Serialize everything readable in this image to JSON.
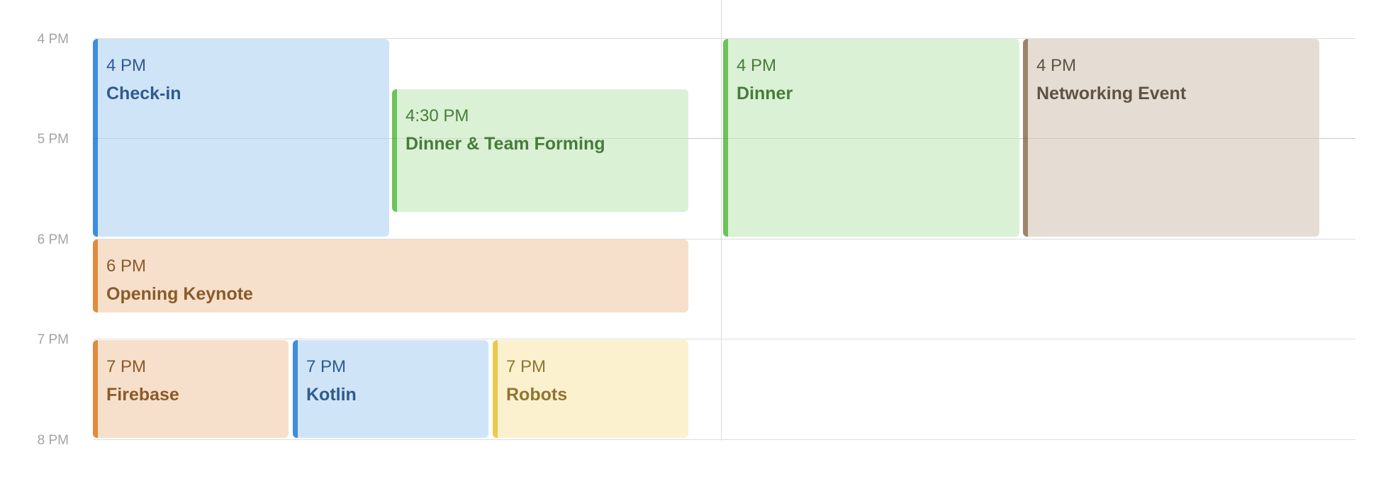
{
  "timeline": {
    "hours": [
      "4 PM",
      "5 PM",
      "6 PM",
      "7 PM",
      "8 PM"
    ]
  },
  "events": {
    "checkin": {
      "time": "4 PM",
      "title": "Check-in"
    },
    "dinnerteam": {
      "time": "4:30 PM",
      "title": "Dinner & Team Forming"
    },
    "dinner": {
      "time": "4 PM",
      "title": "Dinner"
    },
    "networking": {
      "time": "4 PM",
      "title": "Networking Event"
    },
    "keynote": {
      "time": "6 PM",
      "title": "Opening Keynote"
    },
    "firebase": {
      "time": "7 PM",
      "title": "Firebase"
    },
    "kotlin": {
      "time": "7 PM",
      "title": "Kotlin"
    },
    "robots": {
      "time": "7 PM",
      "title": "Robots"
    }
  },
  "colors": {
    "blue": "#3d8de0",
    "green": "#6cc35a",
    "brown": "#9c8569",
    "orange": "#df8c3f",
    "yellow": "#ecc94e",
    "gridline": "#dcdcdc",
    "time_label": "#a4a4a4"
  }
}
